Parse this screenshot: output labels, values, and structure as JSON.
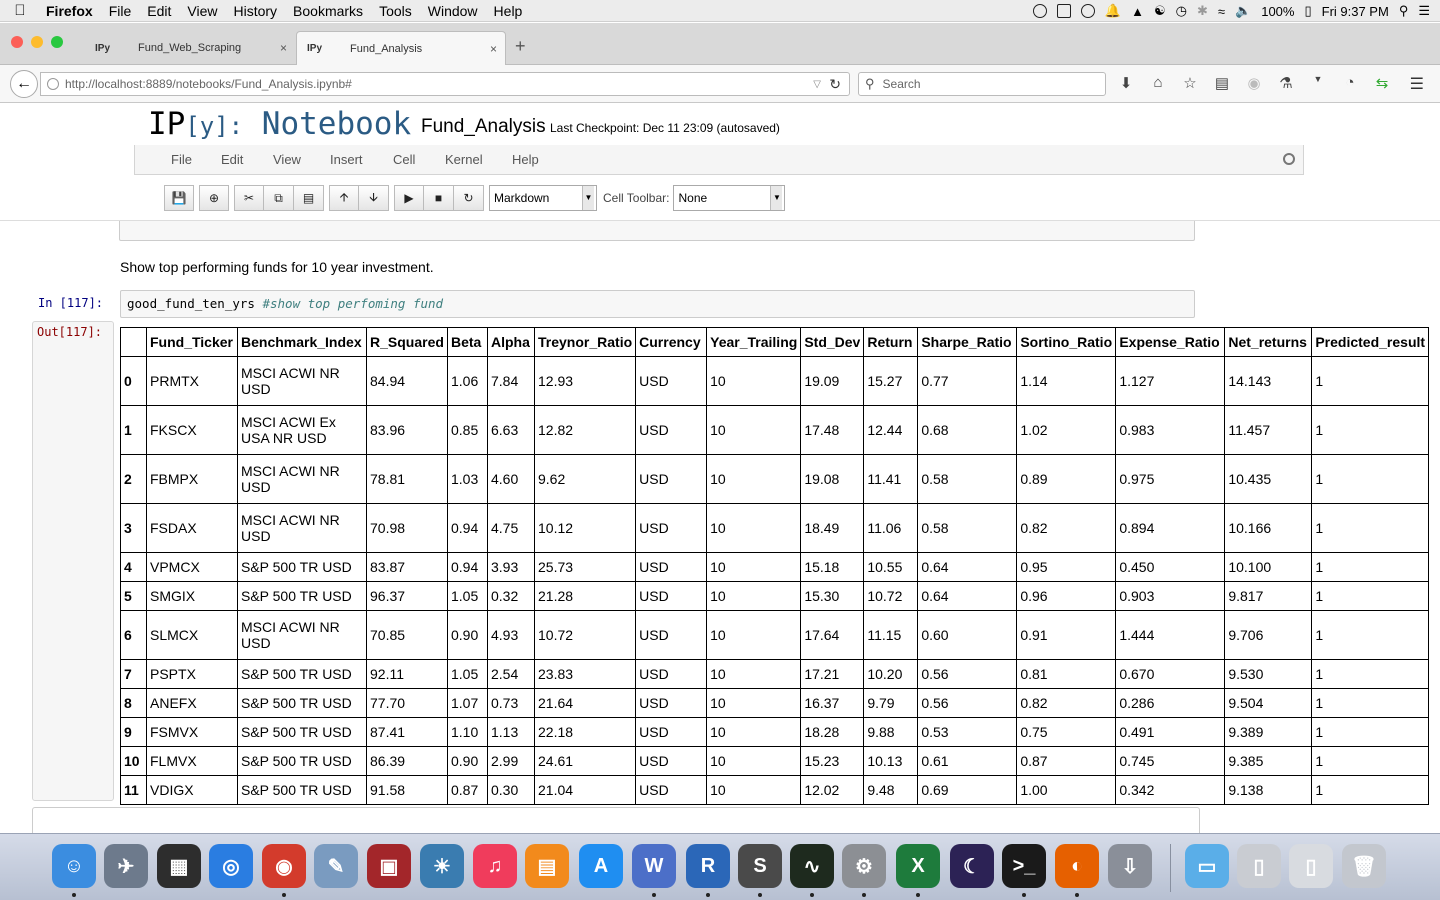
{
  "menubar": {
    "app": "Firefox",
    "items": [
      "File",
      "Edit",
      "View",
      "History",
      "Bookmarks",
      "Tools",
      "Window",
      "Help"
    ],
    "battery": "100%",
    "clock": "Fri 9:37 PM"
  },
  "browser": {
    "tabs": [
      {
        "icon": "IPy",
        "title": "Fund_Web_Scraping",
        "close": "×"
      },
      {
        "icon": "IPy",
        "title": "Fund_Analysis",
        "close": "×"
      }
    ],
    "new_tab": "+",
    "url": "http://localhost:8889/notebooks/Fund_Analysis.ipynb#",
    "search_placeholder": "Search"
  },
  "notebook": {
    "logo_ip": "IP",
    "logo_y": "[y]:",
    "logo_nb": "Notebook",
    "name": "Fund_Analysis",
    "checkpoint": "Last Checkpoint: Dec 11 23:09 (autosaved)",
    "menu": [
      "File",
      "Edit",
      "View",
      "Insert",
      "Cell",
      "Kernel",
      "Help"
    ],
    "cell_type": "Markdown",
    "cell_toolbar_label": "Cell Toolbar:",
    "cell_toolbar_value": "None",
    "markdown_text": "Show top performing funds for 10 year investment.",
    "in_prompt": "In [117]:",
    "code": "good_fund_ten_yrs",
    "code_comment": "#show top perfoming fund",
    "out_prompt": "Out[117]:"
  },
  "table": {
    "columns": [
      "",
      "Fund_Ticker",
      "Benchmark_Index",
      "R_Squared",
      "Beta",
      "Alpha",
      "Treynor_Ratio",
      "Currency",
      "Year_Trailing",
      "Std_Dev",
      "Return",
      "Sharpe_Ratio",
      "Sortino_Ratio",
      "Expense_Ratio",
      "Net_returns",
      "Predicted_result"
    ],
    "rows": [
      [
        "0",
        "PRMTX",
        "MSCI ACWI NR USD",
        "84.94",
        "1.06",
        "7.84",
        "12.93",
        "USD",
        "10",
        "19.09",
        "15.27",
        "0.77",
        "1.14",
        "1.127",
        "14.143",
        "1"
      ],
      [
        "1",
        "FKSCX",
        "MSCI ACWI Ex USA NR USD",
        "83.96",
        "0.85",
        "6.63",
        "12.82",
        "USD",
        "10",
        "17.48",
        "12.44",
        "0.68",
        "1.02",
        "0.983",
        "11.457",
        "1"
      ],
      [
        "2",
        "FBMPX",
        "MSCI ACWI NR USD",
        "78.81",
        "1.03",
        "4.60",
        "9.62",
        "USD",
        "10",
        "19.08",
        "11.41",
        "0.58",
        "0.89",
        "0.975",
        "10.435",
        "1"
      ],
      [
        "3",
        "FSDAX",
        "MSCI ACWI NR USD",
        "70.98",
        "0.94",
        "4.75",
        "10.12",
        "USD",
        "10",
        "18.49",
        "11.06",
        "0.58",
        "0.82",
        "0.894",
        "10.166",
        "1"
      ],
      [
        "4",
        "VPMCX",
        "S&P 500 TR USD",
        "83.87",
        "0.94",
        "3.93",
        "25.73",
        "USD",
        "10",
        "15.18",
        "10.55",
        "0.64",
        "0.95",
        "0.450",
        "10.100",
        "1"
      ],
      [
        "5",
        "SMGIX",
        "S&P 500 TR USD",
        "96.37",
        "1.05",
        "0.32",
        "21.28",
        "USD",
        "10",
        "15.30",
        "10.72",
        "0.64",
        "0.96",
        "0.903",
        "9.817",
        "1"
      ],
      [
        "6",
        "SLMCX",
        "MSCI ACWI NR USD",
        "70.85",
        "0.90",
        "4.93",
        "10.72",
        "USD",
        "10",
        "17.64",
        "11.15",
        "0.60",
        "0.91",
        "1.444",
        "9.706",
        "1"
      ],
      [
        "7",
        "PSPTX",
        "S&P 500 TR USD",
        "92.11",
        "1.05",
        "2.54",
        "23.83",
        "USD",
        "10",
        "17.21",
        "10.20",
        "0.56",
        "0.81",
        "0.670",
        "9.530",
        "1"
      ],
      [
        "8",
        "ANEFX",
        "S&P 500 TR USD",
        "77.70",
        "1.07",
        "0.73",
        "21.64",
        "USD",
        "10",
        "16.37",
        "9.79",
        "0.56",
        "0.82",
        "0.286",
        "9.504",
        "1"
      ],
      [
        "9",
        "FSMVX",
        "S&P 500 TR USD",
        "87.41",
        "1.10",
        "1.13",
        "22.18",
        "USD",
        "10",
        "18.28",
        "9.88",
        "0.53",
        "0.75",
        "0.491",
        "9.389",
        "1"
      ],
      [
        "10",
        "FLMVX",
        "S&P 500 TR USD",
        "86.39",
        "0.90",
        "2.99",
        "24.61",
        "USD",
        "10",
        "15.23",
        "10.13",
        "0.61",
        "0.87",
        "0.745",
        "9.385",
        "1"
      ],
      [
        "11",
        "VDIGX",
        "S&P 500 TR USD",
        "91.58",
        "0.87",
        "0.30",
        "21.04",
        "USD",
        "10",
        "12.02",
        "9.48",
        "0.69",
        "1.00",
        "0.342",
        "9.138",
        "1"
      ]
    ]
  },
  "dock": {
    "items": [
      {
        "name": "finder",
        "color": "#3b8de0",
        "glyph": "☺"
      },
      {
        "name": "launchpad",
        "color": "#6d7a8c",
        "glyph": "✈"
      },
      {
        "name": "dashboard",
        "color": "#2d2d2d",
        "glyph": "▦"
      },
      {
        "name": "safari",
        "color": "#2a7de1",
        "glyph": "◎"
      },
      {
        "name": "chrome",
        "color": "#d33b2c",
        "glyph": "◉"
      },
      {
        "name": "preview",
        "color": "#7a9bc0",
        "glyph": "✎"
      },
      {
        "name": "photo-booth",
        "color": "#a3262a",
        "glyph": "▣"
      },
      {
        "name": "iphoto",
        "color": "#3a7cb0",
        "glyph": "☀"
      },
      {
        "name": "itunes",
        "color": "#f03c5c",
        "glyph": "♫"
      },
      {
        "name": "ibooks",
        "color": "#f28a1c",
        "glyph": "▤"
      },
      {
        "name": "app-store",
        "color": "#1f8ef1",
        "glyph": "A"
      },
      {
        "name": "wolfram",
        "color": "#4c6fc8",
        "glyph": "W"
      },
      {
        "name": "r-app",
        "color": "#2b67b8",
        "glyph": "R"
      },
      {
        "name": "sublime-text",
        "color": "#4a4a4a",
        "glyph": "S"
      },
      {
        "name": "activity-monitor",
        "color": "#1e2a1e",
        "glyph": "∿"
      },
      {
        "name": "system-preferences",
        "color": "#8c8f94",
        "glyph": "⚙"
      },
      {
        "name": "excel",
        "color": "#1e7b3c",
        "glyph": "X"
      },
      {
        "name": "eclipse",
        "color": "#2c2255",
        "glyph": "☾"
      },
      {
        "name": "terminal",
        "color": "#1a1a1a",
        "glyph": ">_"
      },
      {
        "name": "firefox",
        "color": "#e66000",
        "glyph": "◐"
      },
      {
        "name": "downloads-installer",
        "color": "#8a8f99",
        "glyph": "⇩"
      },
      {
        "name": "folder",
        "color": "#5aaee8",
        "glyph": "▭"
      },
      {
        "name": "documents",
        "color": "#c9ccd2",
        "glyph": "▯"
      },
      {
        "name": "preview-doc",
        "color": "#d8dbe0",
        "glyph": "▯"
      },
      {
        "name": "trash",
        "color": "#c3c7ce",
        "glyph": "🗑"
      }
    ]
  }
}
